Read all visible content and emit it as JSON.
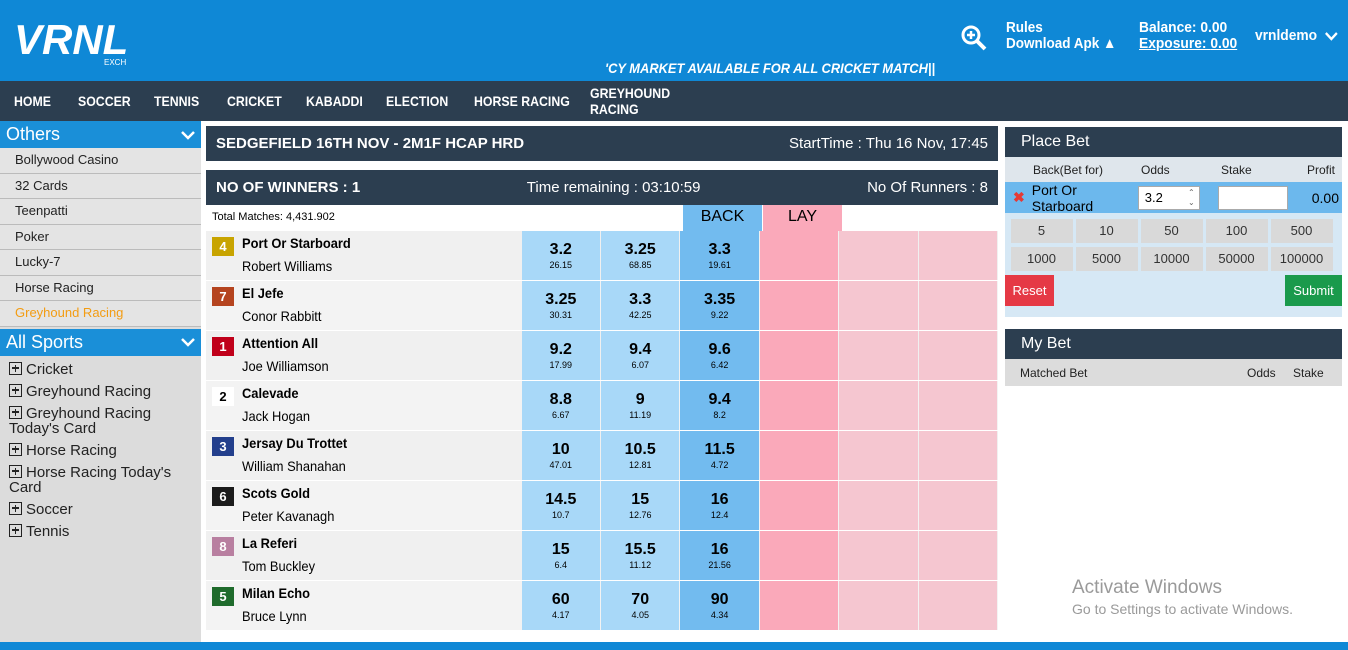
{
  "header": {
    "brand": "VRNL",
    "brand_sub": "EXCH",
    "marquee": "'CY MARKET AVAILABLE FOR ALL CRICKET MATCH||",
    "rules": "Rules",
    "download": "Download Apk",
    "balance_label": "Balance:",
    "balance": "0.00",
    "exposure_label": "Exposure:",
    "exposure": "0.00",
    "username": "vrnldemo"
  },
  "nav": [
    "HOME",
    "SOCCER",
    "TENNIS",
    "CRICKET",
    "KABADDI",
    "ELECTION",
    "HORSE RACING",
    "GREYHOUND RACING"
  ],
  "sidebar": {
    "others_title": "Others",
    "others": [
      "Bollywood Casino",
      "32 Cards",
      "Teenpatti",
      "Poker",
      "Lucky-7",
      "Horse Racing",
      "Greyhound Racing"
    ],
    "sports_title": "All Sports",
    "sports": [
      "Cricket",
      "Greyhound Racing",
      "Greyhound Racing Today's Card",
      "Horse Racing",
      "Horse Racing Today's Card",
      "Soccer",
      "Tennis"
    ]
  },
  "market": {
    "title": "SEDGEFIELD 16TH NOV - 2M1F HCAP HRD",
    "start_time": "StartTime : Thu 16 Nov, 17:45",
    "winners": "NO OF WINNERS : 1",
    "time_remaining": "Time remaining : 03:10:59",
    "runners_count": "No Of Runners : 8",
    "total_matched": "Total Matches: 4,431.902",
    "back_label": "BACK",
    "lay_label": "LAY",
    "runners": [
      {
        "no": "4",
        "color": "#c8a400",
        "name": "Port Or Starboard",
        "jockey": "Robert Williams",
        "back": [
          [
            "3.2",
            "26.15"
          ],
          [
            "3.25",
            "68.85"
          ],
          [
            "3.3",
            "19.61"
          ]
        ]
      },
      {
        "no": "7",
        "color": "#b5441f",
        "name": "El Jefe",
        "jockey": "Conor Rabbitt",
        "back": [
          [
            "3.25",
            "30.31"
          ],
          [
            "3.3",
            "42.25"
          ],
          [
            "3.35",
            "9.22"
          ]
        ]
      },
      {
        "no": "1",
        "color": "#c0001a",
        "name": "Attention All",
        "jockey": "Joe Williamson",
        "back": [
          [
            "9.2",
            "17.99"
          ],
          [
            "9.4",
            "6.07"
          ],
          [
            "9.6",
            "6.42"
          ]
        ]
      },
      {
        "no": "2",
        "color": "#ffffff",
        "name": "Calevade",
        "jockey": "Jack Hogan",
        "back": [
          [
            "8.8",
            "6.67"
          ],
          [
            "9",
            "11.19"
          ],
          [
            "9.4",
            "8.2"
          ]
        ]
      },
      {
        "no": "3",
        "color": "#233f8c",
        "name": "Jersay Du Trottet",
        "jockey": "William Shanahan",
        "back": [
          [
            "10",
            "47.01"
          ],
          [
            "10.5",
            "12.81"
          ],
          [
            "11.5",
            "4.72"
          ]
        ]
      },
      {
        "no": "6",
        "color": "#1c1c1c",
        "name": "Scots Gold",
        "jockey": "Peter Kavanagh",
        "back": [
          [
            "14.5",
            "10.7"
          ],
          [
            "15",
            "12.76"
          ],
          [
            "16",
            "12.4"
          ]
        ]
      },
      {
        "no": "8",
        "color": "#b87fa0",
        "name": "La Referi",
        "jockey": "Tom Buckley",
        "back": [
          [
            "15",
            "6.4"
          ],
          [
            "15.5",
            "11.12"
          ],
          [
            "16",
            "21.56"
          ]
        ]
      },
      {
        "no": "5",
        "color": "#1f6b2c",
        "name": "Milan Echo",
        "jockey": "Bruce Lynn",
        "back": [
          [
            "60",
            "4.17"
          ],
          [
            "70",
            "4.05"
          ],
          [
            "90",
            "4.34"
          ]
        ]
      }
    ]
  },
  "placebet": {
    "title": "Place Bet",
    "col_back": "Back(Bet for)",
    "col_odds": "Odds",
    "col_stake": "Stake",
    "col_profit": "Profit",
    "runner": "Port Or Starboard",
    "odds": "3.2",
    "profit": "0.00",
    "stakes": [
      "5",
      "10",
      "50",
      "100",
      "500",
      "1000",
      "5000",
      "10000",
      "50000",
      "100000"
    ],
    "reset": "Reset",
    "submit": "Submit"
  },
  "mybet": {
    "title": "My Bet",
    "col_matched": "Matched Bet",
    "col_odds": "Odds",
    "col_stake": "Stake"
  },
  "watermark": {
    "line1": "Activate Windows",
    "line2": "Go to Settings to activate Windows."
  }
}
